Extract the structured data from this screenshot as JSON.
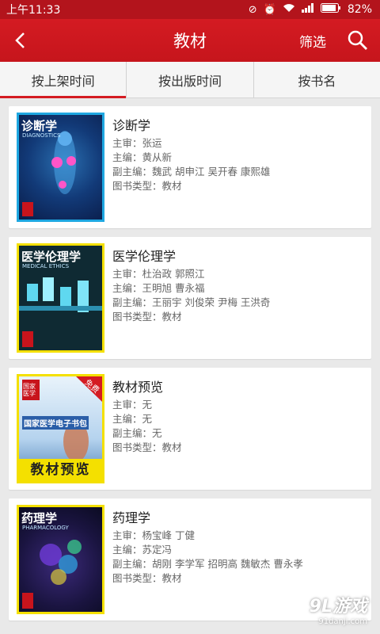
{
  "status_bar": {
    "time": "上午11:33",
    "battery": "82%"
  },
  "header": {
    "title": "教材",
    "filter_label": "筛选"
  },
  "tabs": [
    {
      "label": "按上架时间"
    },
    {
      "label": "按出版时间"
    },
    {
      "label": "按书名"
    }
  ],
  "books": [
    {
      "name": "诊断学",
      "reviewer": "主审：张运",
      "editor": "主编：黄从新",
      "associate": "副主编：魏武 胡申江 吴开春 康熙雄",
      "type": "图书类型：教材",
      "cover": {
        "title": "诊断学",
        "subtitle": "DIAGNOSTICS"
      }
    },
    {
      "name": "医学伦理学",
      "reviewer": "主审：杜治政 郭照江",
      "editor": "主编：王明旭 曹永福",
      "associate": "副主编：王丽宇 刘俊荣 尹梅 王洪奇",
      "type": "图书类型：教材",
      "cover": {
        "title": "医学伦理学",
        "subtitle": "MEDICAL ETHICS"
      }
    },
    {
      "name": "教材预览",
      "reviewer": "主审：无",
      "editor": "主编：无",
      "associate": "副主编：无",
      "type": "图书类型：教材",
      "cover": {
        "badge": "免费",
        "publisher": "国家医学",
        "headline": "国家医学电子书包",
        "bottom": "教材预览"
      }
    },
    {
      "name": "药理学",
      "reviewer": "主审：杨宝峰 丁健",
      "editor": "主编：苏定冯",
      "associate": "副主编：胡刚 李学军 招明高 魏敏杰 曹永孝",
      "type": "图书类型：教材",
      "cover": {
        "title": "药理学",
        "subtitle": "PHARMACOLOGY"
      }
    }
  ],
  "watermark": {
    "main": "9L游戏",
    "sub": "91danji.com"
  }
}
